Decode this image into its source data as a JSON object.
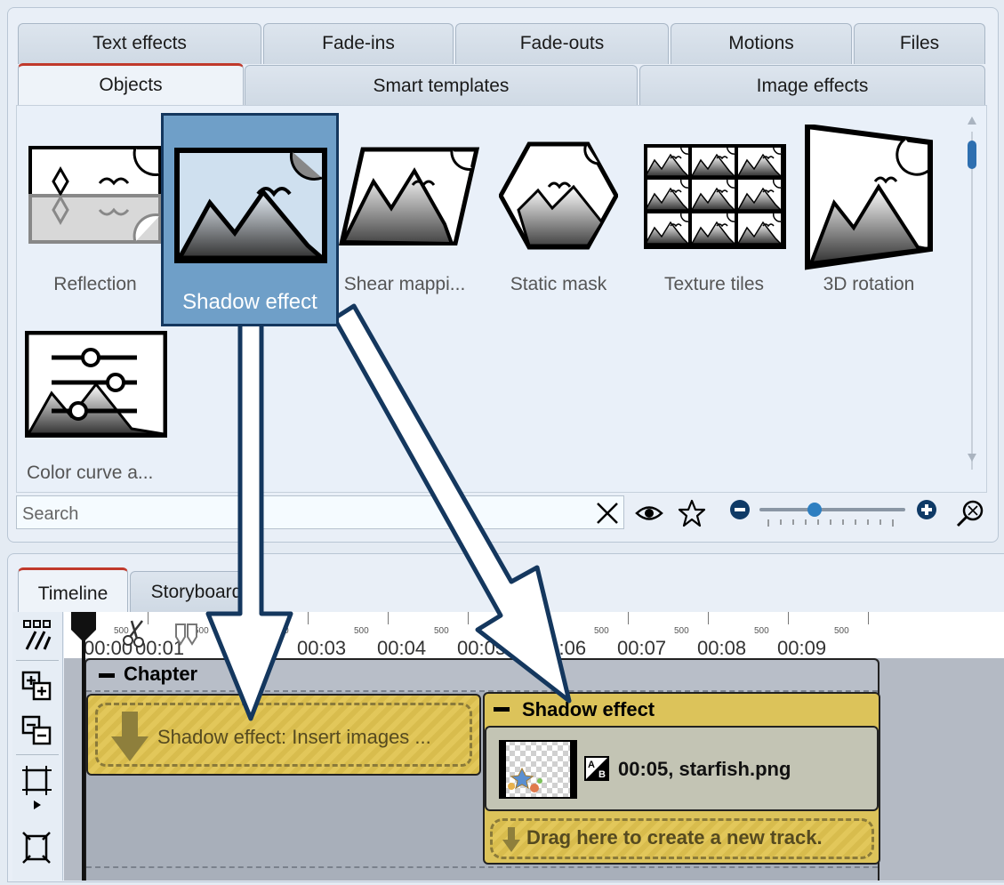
{
  "effects_panel": {
    "tabs_row1": [
      "Text effects",
      "Fade-ins",
      "Fade-outs",
      "Motions",
      "Files"
    ],
    "tabs_row2": [
      "Objects",
      "Smart templates",
      "Image effects"
    ],
    "active_tab": "Objects",
    "items": [
      {
        "label": "Reflection",
        "icon": "reflection-icon"
      },
      {
        "label": "Shadow effect",
        "icon": "shadow-effect-icon",
        "selected": true
      },
      {
        "label": "Shear mappi...",
        "icon": "shear-mapping-icon"
      },
      {
        "label": "Static mask",
        "icon": "static-mask-icon"
      },
      {
        "label": "Texture tiles",
        "icon": "texture-tiles-icon"
      },
      {
        "label": "3D rotation",
        "icon": "3d-rotation-icon"
      },
      {
        "label": "Color curve a...",
        "icon": "color-curve-icon"
      }
    ],
    "search": {
      "placeholder": "Search",
      "value": ""
    }
  },
  "timeline_panel": {
    "tabs": [
      "Timeline",
      "Storyboard"
    ],
    "active_tab": "Timeline",
    "ruler": {
      "labels": [
        "00:00",
        "00:01",
        "00:03",
        "00:04",
        "00:05",
        "00:06",
        "00:07",
        "00:08",
        "00:09"
      ],
      "minor_label": "500"
    },
    "chapter": {
      "title": "Chapter"
    },
    "placeholder_clip": {
      "text": "Shadow effect: Insert images ..."
    },
    "effect_group": {
      "title": "Shadow effect",
      "clip_text": "00:05, starfish.png",
      "drop_zone_text": "Drag here to create a new track."
    }
  },
  "colors": {
    "accent_red": "#c0392b",
    "selection_blue": "#6f9fc8",
    "arrow_outline": "#14375e",
    "clip_yellow": "#dcc35a"
  }
}
